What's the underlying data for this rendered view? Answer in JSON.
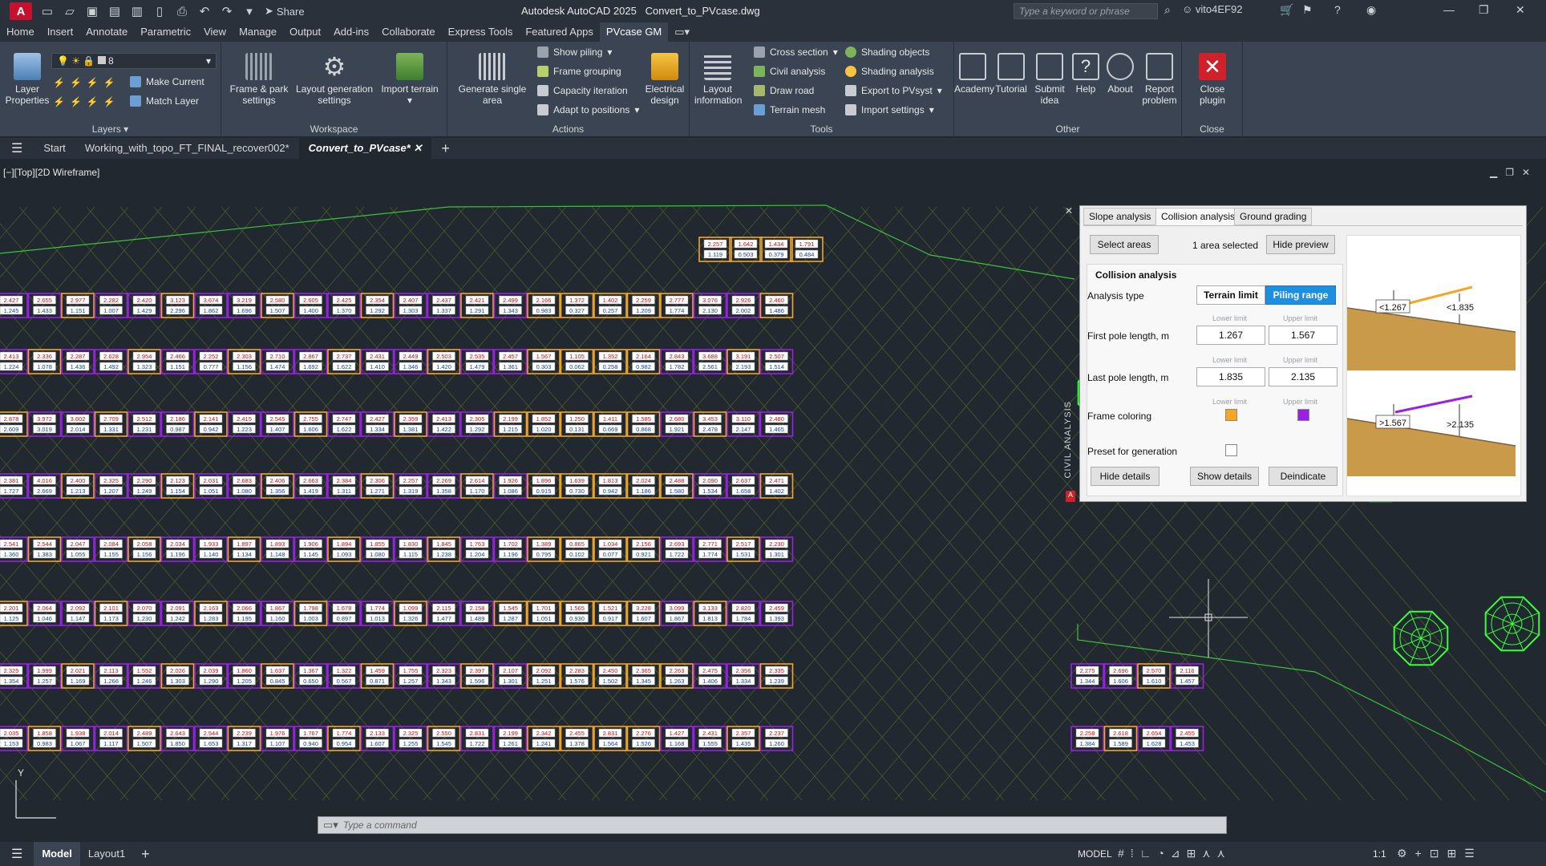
{
  "app": {
    "title": "Autodesk AutoCAD 2025",
    "file": "Convert_to_PVcase.dwg",
    "share_label": "Share",
    "search_placeholder": "Type a keyword or phrase",
    "user": "vito4EF92"
  },
  "ribbon_tabs": [
    "Home",
    "Insert",
    "Annotate",
    "Parametric",
    "View",
    "Manage",
    "Output",
    "Add-ins",
    "Collaborate",
    "Express Tools",
    "Featured Apps",
    "PVcase GM"
  ],
  "ribbon_active_tab": "PVcase GM",
  "ribbon": {
    "layers": {
      "title": "Layers",
      "layer_properties": "Layer\nProperties",
      "layer_value": "8",
      "make_current": "Make Current",
      "match_layer": "Match Layer"
    },
    "workspace": {
      "title": "Workspace",
      "frame_park": "Frame & park\nsettings",
      "layout_generation": "Layout generation\nsettings",
      "import_terrain": "Import terrain"
    },
    "actions": {
      "title": "Actions",
      "generate_single": "Generate single\narea",
      "show_piling": "Show piling",
      "frame_grouping": "Frame grouping",
      "capacity_iteration": "Capacity iteration",
      "adapt_positions": "Adapt to positions",
      "electrical_design": "Electrical\ndesign"
    },
    "tools": {
      "title": "Tools",
      "layout_information": "Layout\ninformation",
      "cross_section": "Cross section",
      "civil_analysis": "Civil analysis",
      "draw_road": "Draw road",
      "terrain_mesh": "Terrain mesh",
      "shading_objects": "Shading objects",
      "shading_analysis": "Shading analysis",
      "export_pvsyst": "Export to PVsyst",
      "import_settings": "Import settings"
    },
    "other": {
      "title": "Other",
      "academy": "Academy",
      "tutorial": "Tutorial",
      "submit_idea": "Submit\nidea",
      "help": "Help",
      "about": "About",
      "report_problem": "Report\nproblem"
    },
    "close": {
      "title": "Close",
      "close_plugin": "Close\nplugin"
    }
  },
  "doc_tabs": [
    "Start",
    "Working_with_topo_FT_FINAL_recover002*",
    "Convert_to_PVcase*"
  ],
  "viewport_label": "[−][Top][2D Wireframe]",
  "panel": {
    "tabs": [
      "Slope analysis",
      "Collision analysis",
      "Ground grading"
    ],
    "active_tab": "Collision analysis",
    "select_areas": "Select areas",
    "areas_selected": "1 area selected",
    "hide_preview": "Hide preview",
    "section_title": "Collision analysis",
    "analysis_type_label": "Analysis type",
    "terrain_limit": "Terrain limit",
    "piling_range": "Piling range",
    "lower_limit": "Lower limit",
    "upper_limit": "Upper limit",
    "first_pole_label": "First pole length, m",
    "first_pole_lower": "1.267",
    "first_pole_upper": "1.567",
    "last_pole_label": "Last pole length, m",
    "last_pole_lower": "1.835",
    "last_pole_upper": "2.135",
    "frame_coloring_label": "Frame coloring",
    "frame_color_lower": "#f5a623",
    "frame_color_upper": "#9b1fe8",
    "preset_label": "Preset for generation",
    "hide_details": "Hide details",
    "show_details": "Show details",
    "deindicate": "Deindicate",
    "diagram_top_left": "<1.267",
    "diagram_top_right": "<1.835",
    "diagram_bottom_left": ">1.567",
    "diagram_bottom_right": ">2.135",
    "side_label": "CIVIL ANALYSIS"
  },
  "command_placeholder": "Type a command",
  "status": {
    "model_tab": "Model",
    "layout_tab": "Layout1",
    "model_label": "MODEL",
    "scale": "1:1"
  },
  "rows": [
    {
      "top": [
        "2.257",
        "1.642",
        "1.434",
        "1.791"
      ],
      "bot": [
        "1.119",
        "0.503",
        "0.379",
        "0.484"
      ]
    },
    {
      "top": [
        "2.427",
        "2.655",
        "2.977",
        "2.282",
        "2.420",
        "3.123",
        "3.674",
        "3.219",
        "2.580",
        "2.605",
        "2.425",
        "2.354",
        "2.407",
        "2.437",
        "2.421",
        "2.499",
        "2.166",
        "1.372",
        "1.402",
        "2.259",
        "2.777",
        "3.076",
        "2.926",
        "2.460"
      ],
      "bot": [
        "1.245",
        "1.433",
        "1.151",
        "1.007",
        "1.429",
        "2.296",
        "1.862",
        "1.696",
        "1.507",
        "1.400",
        "1.370",
        "1.292",
        "1.303",
        "1.337",
        "1.291",
        "1.343",
        "0.983",
        "0.327",
        "0.257",
        "1.209",
        "1.774",
        "2.130",
        "2.002",
        "1.486"
      ]
    },
    {
      "top": [
        "2.413",
        "2.336",
        "2.287",
        "2.628",
        "2.954",
        "2.466",
        "2.252",
        "2.303",
        "2.710",
        "2.867",
        "2.737",
        "2.431",
        "2.449",
        "2.503",
        "2.535",
        "2.457",
        "1.567",
        "1.105",
        "1.352",
        "2.164",
        "2.843",
        "3.688",
        "3.191",
        "2.507"
      ],
      "bot": [
        "1.224",
        "1.078",
        "1.436",
        "1.492",
        "1.323",
        "1.151",
        "0.777",
        "1.156",
        "1.474",
        "1.692",
        "1.622",
        "1.410",
        "1.346",
        "1.420",
        "1.479",
        "1.361",
        "0.303",
        "0.062",
        "0.258",
        "0.982",
        "1.782",
        "2.561",
        "2.193",
        "1.514"
      ]
    },
    {
      "top": [
        "2.878",
        "3.972",
        "3.602",
        "2.709",
        "2.512",
        "2.186",
        "2.141",
        "2.415",
        "2.545",
        "2.755",
        "2.747",
        "2.427",
        "2.359",
        "2.413",
        "2.305",
        "2.199",
        "1.852",
        "1.250",
        "1.411",
        "1.585",
        "2.680",
        "3.453",
        "3.110",
        "2.480"
      ],
      "bot": [
        "2.609",
        "3.019",
        "2.014",
        "1.331",
        "1.231",
        "0.987",
        "0.942",
        "1.223",
        "1.407",
        "1.606",
        "1.622",
        "1.334",
        "1.381",
        "1.422",
        "1.292",
        "1.215",
        "1.020",
        "0.131",
        "0.669",
        "0.868",
        "1.921",
        "2.478",
        "2.147",
        "1.465"
      ]
    },
    {
      "top": [
        "2.381",
        "4.016",
        "2.400",
        "2.325",
        "2.290",
        "2.123",
        "2.031",
        "2.683",
        "2.406",
        "2.663",
        "2.384",
        "2.306",
        "2.257",
        "2.269",
        "2.614",
        "1.926",
        "1.896",
        "1.639",
        "1.813",
        "2.024",
        "2.488",
        "2.090",
        "2.637",
        "2.471"
      ],
      "bot": [
        "1.727",
        "2.669",
        "1.213",
        "1.207",
        "1.249",
        "1.154",
        "1.051",
        "1.080",
        "1.356",
        "1.419",
        "1.311",
        "1.271",
        "1.319",
        "1.358",
        "1.170",
        "1.086",
        "0.915",
        "0.730",
        "0.942",
        "1.186",
        "1.580",
        "1.534",
        "1.658",
        "1.402"
      ]
    },
    {
      "top": [
        "2.541",
        "2.544",
        "2.047",
        "2.084",
        "2.058",
        "2.034",
        "1.933",
        "1.897",
        "1.893",
        "1.906",
        "1.894",
        "1.855",
        "1.830",
        "1.845",
        "1.763",
        "1.702",
        "1.389",
        "0.865",
        "1.034",
        "2.156",
        "2.693",
        "2.771",
        "2.517",
        "2.230"
      ],
      "bot": [
        "1.360",
        "1.383",
        "1.055",
        "1.155",
        "1.156",
        "1.196",
        "1.140",
        "1.134",
        "1.148",
        "1.145",
        "1.093",
        "1.080",
        "1.115",
        "1.238",
        "1.204",
        "1.196",
        "0.795",
        "0.102",
        "0.077",
        "0.921",
        "1.722",
        "1.774",
        "1.531",
        "1.301"
      ]
    },
    {
      "top": [
        "2.201",
        "2.064",
        "2.092",
        "2.101",
        "2.070",
        "2.091",
        "2.163",
        "2.066",
        "1.867",
        "1.798",
        "1.678",
        "1.774",
        "1.099",
        "2.115",
        "2.158",
        "1.545",
        "1.701",
        "1.565",
        "1.521",
        "3.228",
        "3.099",
        "3.133",
        "2.820",
        "2.459"
      ],
      "bot": [
        "1.125",
        "1.046",
        "1.147",
        "1.173",
        "1.230",
        "1.242",
        "1.283",
        "1.195",
        "1.160",
        "1.003",
        "0.897",
        "1.013",
        "1.326",
        "1.477",
        "1.489",
        "1.287",
        "1.051",
        "0.930",
        "0.917",
        "1.607",
        "1.867",
        "1.813",
        "1.784",
        "1.393"
      ]
    },
    {
      "top": [
        "2.325",
        "1.999",
        "2.021",
        "2.113",
        "1.552",
        "2.026",
        "2.039",
        "1.860",
        "1.637",
        "1.367",
        "1.322",
        "1.459",
        "1.755",
        "2.323",
        "2.397",
        "2.107",
        "2.092",
        "2.283",
        "2.450",
        "2.365",
        "2.263",
        "2.475",
        "2.356",
        "2.335",
        "2.275",
        "2.696",
        "2.570",
        "2.116"
      ],
      "bot": [
        "1.354",
        "1.257",
        "1.169",
        "1.266",
        "1.246",
        "1.303",
        "1.290",
        "1.205",
        "0.845",
        "0.650",
        "0.567",
        "0.871",
        "1.257",
        "1.343",
        "1.596",
        "1.301",
        "1.251",
        "1.576",
        "1.502",
        "1.345",
        "1.263",
        "1.406",
        "1.334",
        "1.239",
        "1.344",
        "1.606",
        "1.610",
        "1.457"
      ]
    },
    {
      "top": [
        "2.035",
        "1.858",
        "1.938",
        "2.014",
        "2.489",
        "2.643",
        "2.544",
        "2.239",
        "1.976",
        "1.767",
        "1.774",
        "2.133",
        "2.325",
        "2.550",
        "2.831",
        "2.199",
        "2.342",
        "2.455",
        "2.831",
        "2.276",
        "1.427",
        "2.431",
        "2.357",
        "2.237",
        "2.258",
        "2.618",
        "2.654",
        "2.455"
      ],
      "bot": [
        "1.153",
        "0.983",
        "1.067",
        "1.117",
        "1.507",
        "1.850",
        "1.653",
        "1.317",
        "1.107",
        "0.940",
        "0.954",
        "1.607",
        "1.255",
        "1.545",
        "1.722",
        "1.261",
        "1.241",
        "1.378",
        "1.564",
        "1.526",
        "1.168",
        "1.555",
        "1.435",
        "1.260",
        "1.384",
        "1.589",
        "1.628",
        "1.453"
      ]
    }
  ]
}
